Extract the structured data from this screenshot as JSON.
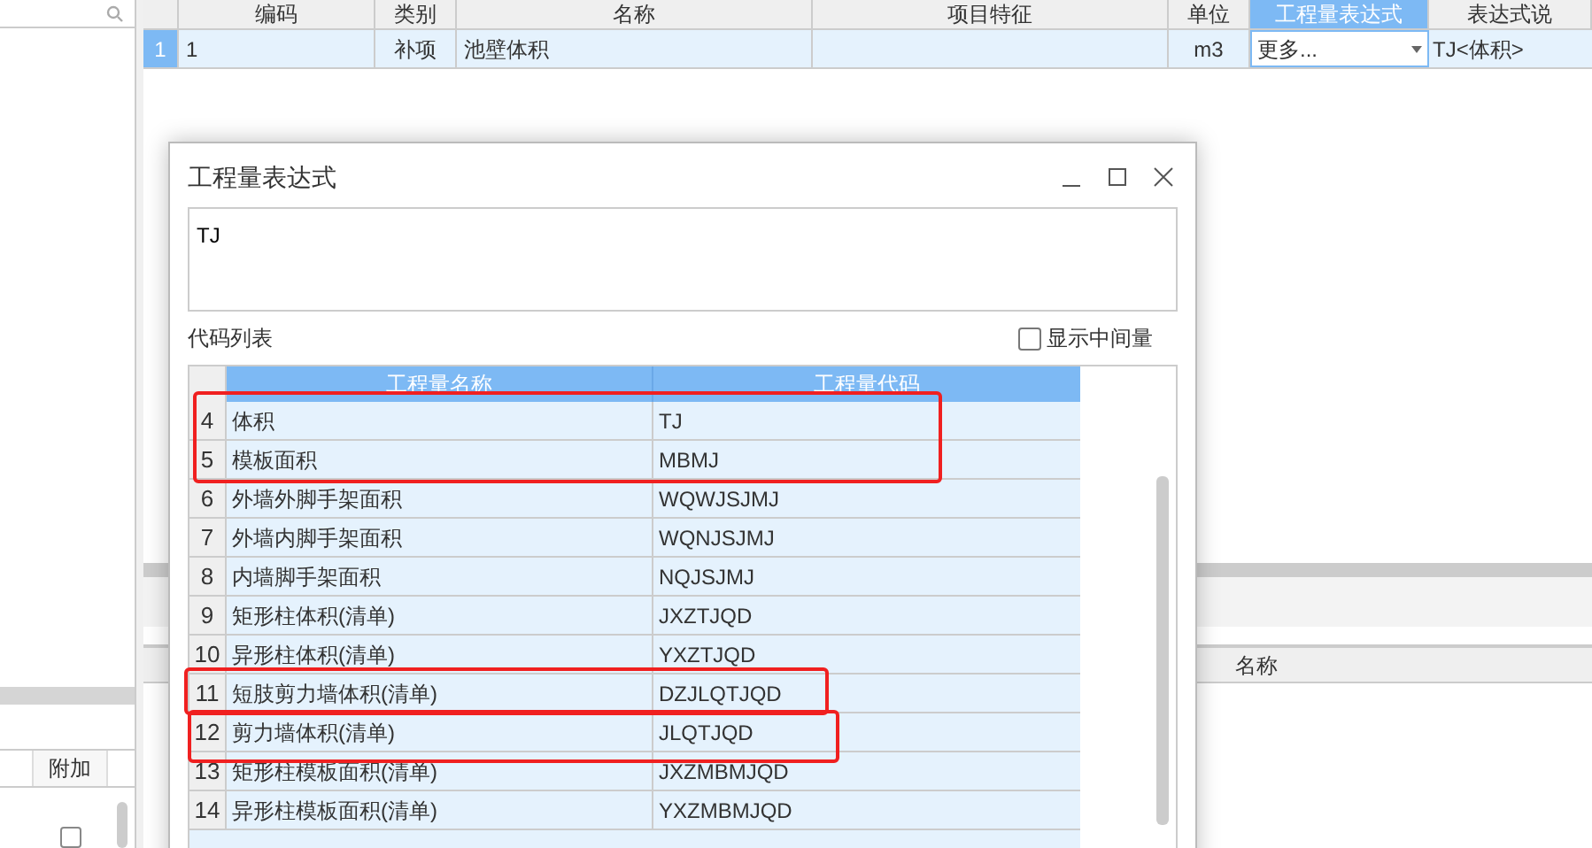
{
  "main_table": {
    "columns": [
      {
        "label": "编码",
        "selected": false
      },
      {
        "label": "类别",
        "selected": false
      },
      {
        "label": "名称",
        "selected": false
      },
      {
        "label": "项目特征",
        "selected": false
      },
      {
        "label": "单位",
        "selected": false
      },
      {
        "label": "工程量表达式",
        "selected": true
      },
      {
        "label": "表达式说"
      }
    ],
    "rows": [
      {
        "number": "1",
        "selected": true,
        "code": "1",
        "type": "补项",
        "name": "池壁体积",
        "unit": "m3",
        "expression": "更多...",
        "description": "TJ<体积>"
      }
    ]
  },
  "lower_table": {
    "columns": [
      "名称"
    ]
  },
  "side_table": {
    "columns": [
      "附加"
    ],
    "rows": [
      {
        "checked": false
      }
    ]
  },
  "dialog": {
    "title": "工程量表达式",
    "expression": "TJ",
    "list_label": "代码列表",
    "show_intermediate": {
      "label": "显示中间量",
      "checked": false
    },
    "columns": [
      "工程量名称",
      "工程量代码"
    ],
    "rows": [
      {
        "number": "4",
        "name": "体积",
        "code": "TJ"
      },
      {
        "number": "5",
        "name": "模板面积",
        "code": "MBMJ"
      },
      {
        "number": "6",
        "name": "外墙外脚手架面积",
        "code": "WQWJSJMJ"
      },
      {
        "number": "7",
        "name": "外墙内脚手架面积",
        "code": "WQNJSJMJ"
      },
      {
        "number": "8",
        "name": "内墙脚手架面积",
        "code": "NQJSJMJ"
      },
      {
        "number": "9",
        "name": "矩形柱体积(清单)",
        "code": "JXZTJQD"
      },
      {
        "number": "10",
        "name": "异形柱体积(清单)",
        "code": "YXZTJQD"
      },
      {
        "number": "11",
        "name": "短肢剪力墙体积(清单)",
        "code": "DZJLQTJQD"
      },
      {
        "number": "12",
        "name": "剪力墙体积(清单)",
        "code": "JLQTJQD"
      },
      {
        "number": "13",
        "name": "矩形柱模板面积(清单)",
        "code": "JXZMBMJQD"
      },
      {
        "number": "14",
        "name": "异形柱模板面积(清单)",
        "code": "YXZMBMJQD"
      }
    ]
  }
}
